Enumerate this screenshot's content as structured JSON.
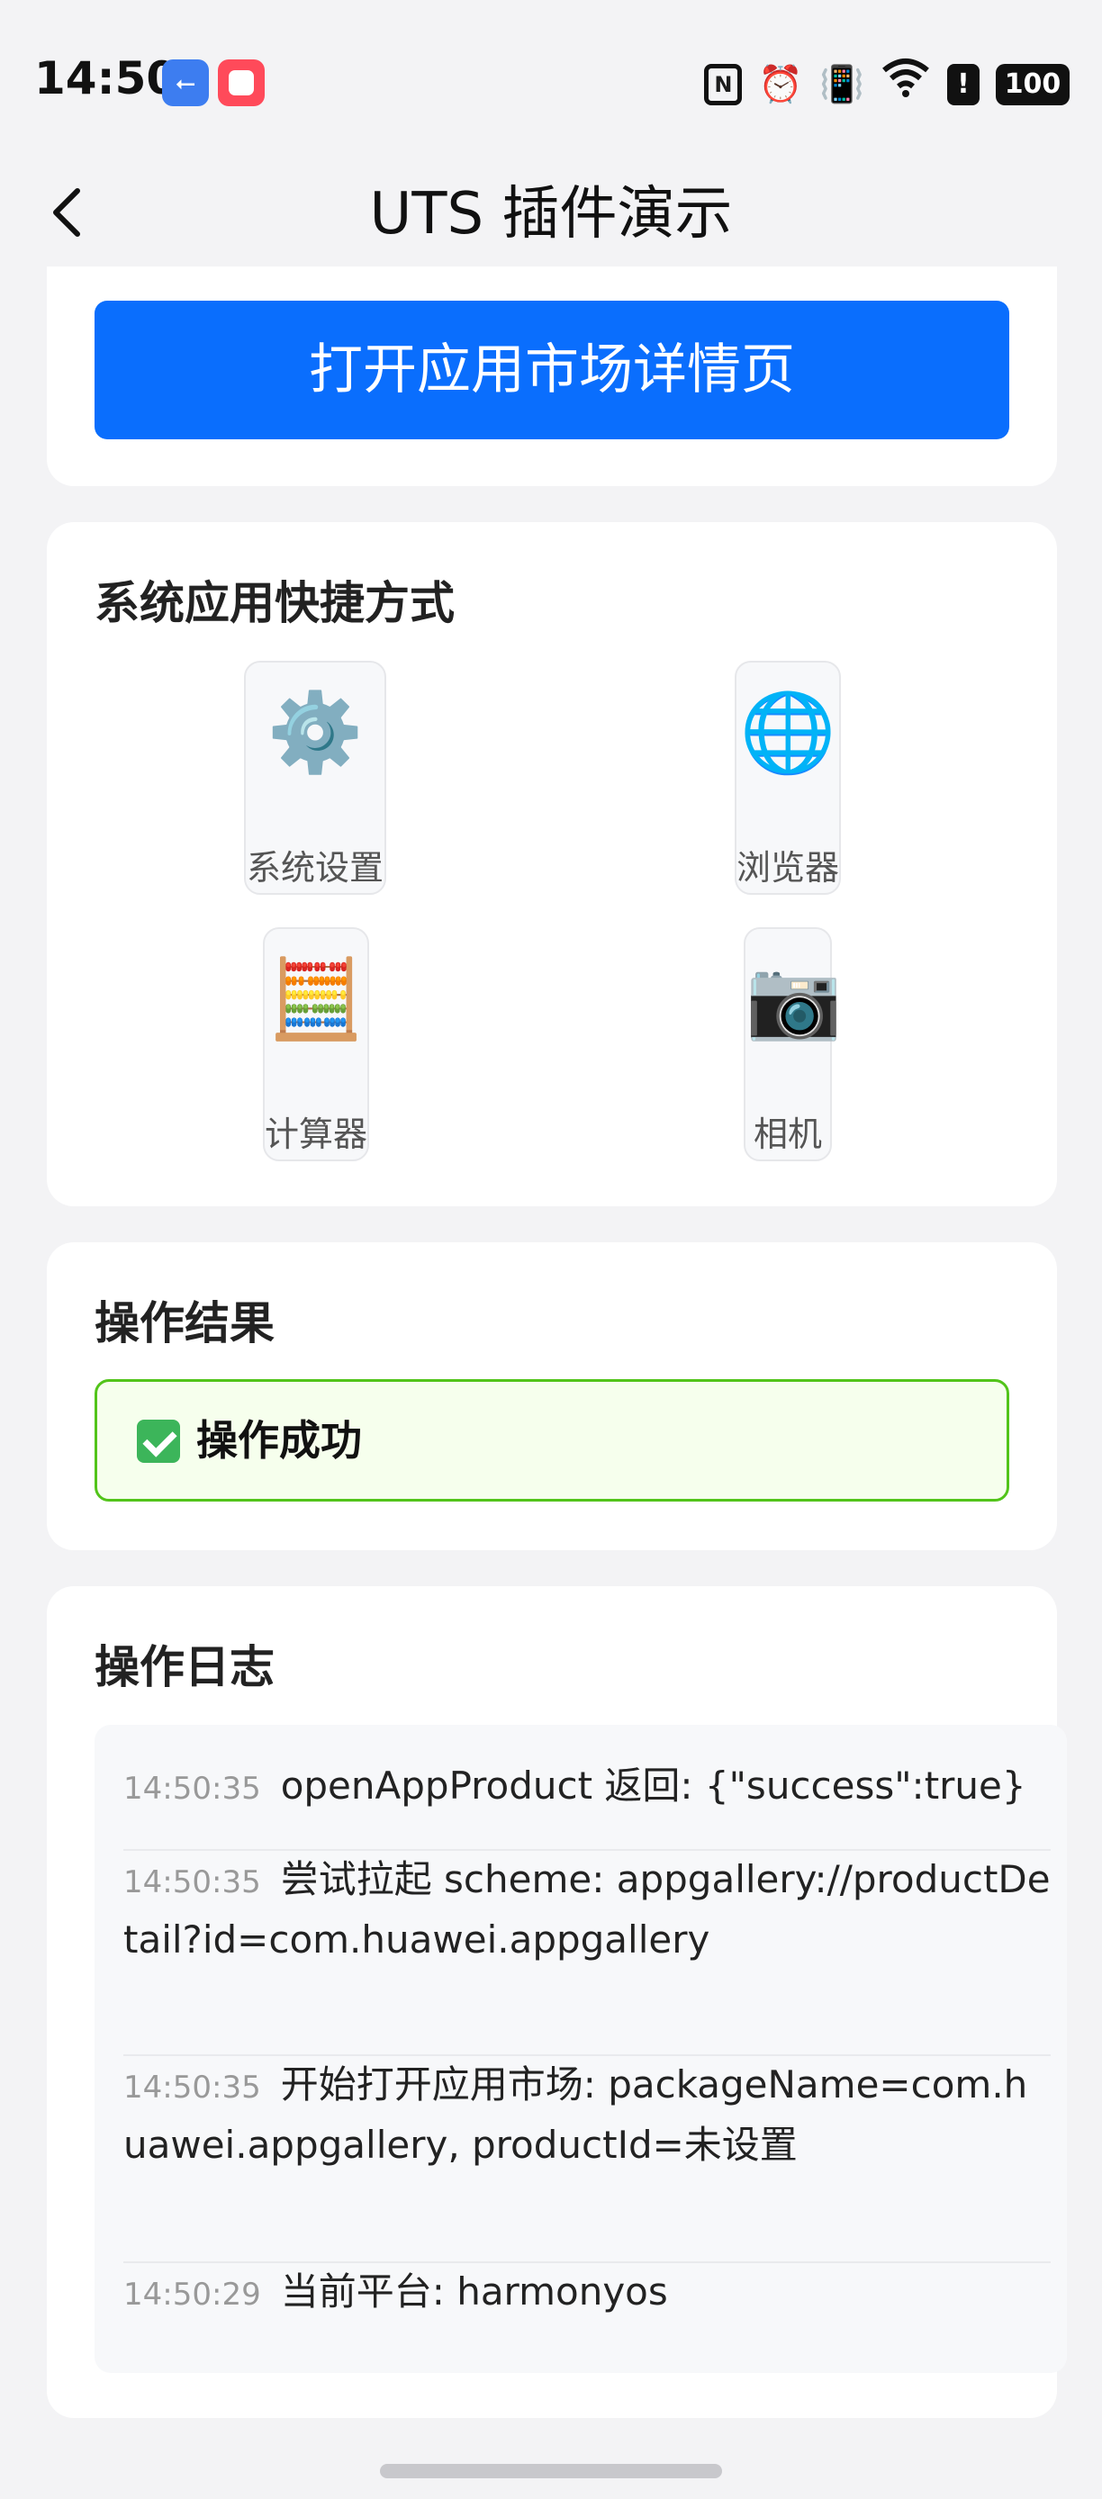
{
  "status_bar": {
    "time": "14:50",
    "battery": "100",
    "icons": [
      "usb-icon",
      "app-notification-icon",
      "nfc-icon",
      "alarm-icon",
      "vibrate-icon",
      "wifi-icon",
      "alert-icon",
      "battery-icon"
    ]
  },
  "nav": {
    "title": "UTS 插件演示",
    "back_icon": "chevron-left-icon"
  },
  "card1": {
    "button_label": "打开应用市场详情页",
    "button_color": "#0a6efd"
  },
  "shortcuts": {
    "title": "系统应用快捷方式",
    "items": [
      {
        "label": "系统设置",
        "icon": "⚙️"
      },
      {
        "label": "浏览器",
        "icon": "🌐"
      },
      {
        "label": "计算器",
        "icon": "🧮"
      },
      {
        "label": "相机",
        "icon": "📷"
      }
    ]
  },
  "result": {
    "title": "操作结果",
    "status_text": "操作成功",
    "status_color": "#52c41a"
  },
  "log": {
    "title": "操作日志",
    "entries": [
      {
        "time": "14:50:35",
        "text": "openAppProduct 返回: {\"success\":true}"
      },
      {
        "time": "14:50:35",
        "text": "尝试拉起 scheme: appgallery://productDetail?id=com.huawei.appgallery"
      },
      {
        "time": "14:50:35",
        "text": "开始打开应用市场: packageName=com.huawei.appgallery, productId=未设置"
      },
      {
        "time": "14:50:29",
        "text": "当前平台: harmonyos"
      }
    ]
  }
}
